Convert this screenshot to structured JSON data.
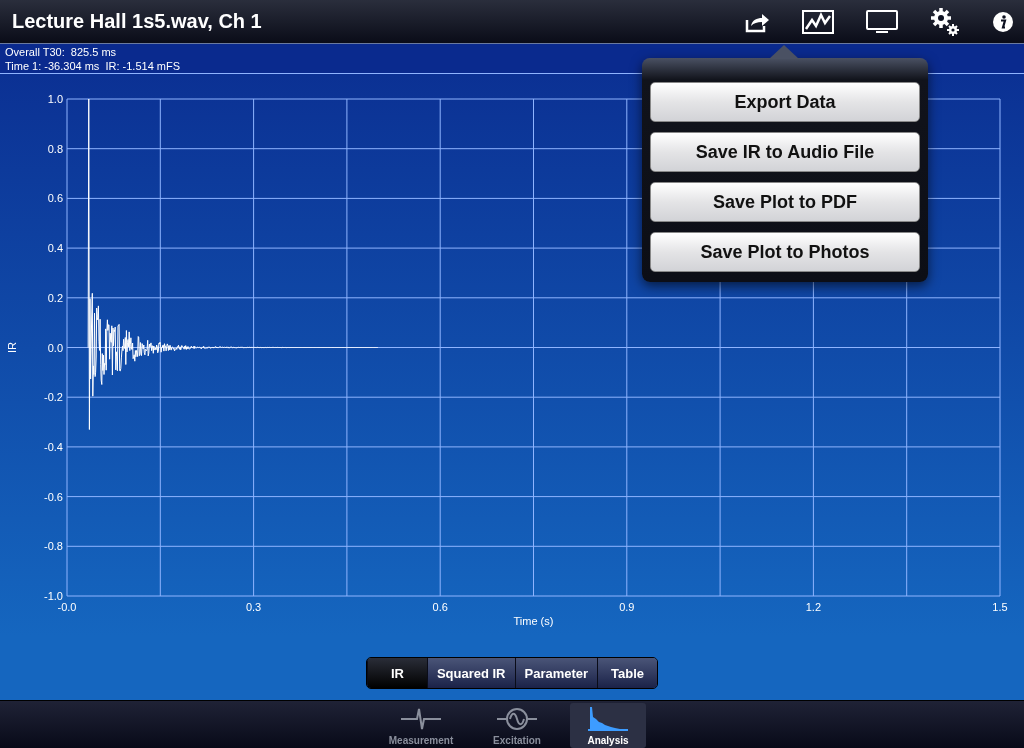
{
  "window": {
    "title": "Lecture Hall 1s5.wav, Ch 1"
  },
  "info": [
    "Overall T30:  825.5 ms",
    "Time 1: -36.304 ms  IR: -1.514 mFS"
  ],
  "chart": {
    "xlabel": "Time (s)",
    "ylabel": "IR",
    "xticks": [
      "-0.0",
      "0.3",
      "0.6",
      "0.9",
      "1.2",
      "1.5"
    ],
    "yticks": [
      "1.0",
      "0.8",
      "0.6",
      "0.4",
      "0.2",
      "0.0",
      "-0.2",
      "-0.4",
      "-0.6",
      "-0.8",
      "-1.0"
    ]
  },
  "menu": [
    "Export Data",
    "Save IR to Audio File",
    "Save Plot to PDF",
    "Save Plot to Photos"
  ],
  "segments": [
    {
      "label": "IR",
      "selected": true
    },
    {
      "label": "Squared IR",
      "selected": false
    },
    {
      "label": "Parameter",
      "selected": false
    },
    {
      "label": "Table",
      "selected": false
    }
  ],
  "tabs": [
    {
      "label": "Measurement",
      "kind": "measurement",
      "selected": false
    },
    {
      "label": "Excitation",
      "kind": "excitation",
      "selected": false
    },
    {
      "label": "Analysis",
      "kind": "analysis",
      "selected": true
    }
  ]
}
